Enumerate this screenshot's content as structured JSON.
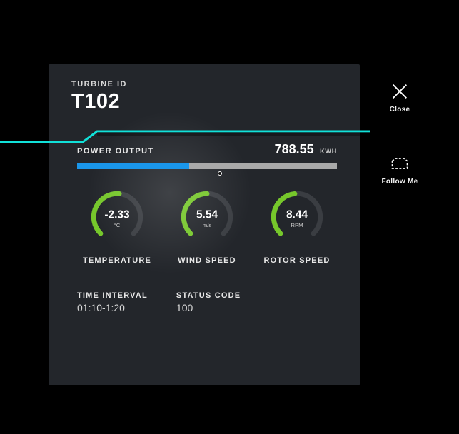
{
  "header": {
    "id_label": "TURBINE ID",
    "id_value": "T102"
  },
  "power": {
    "label": "POWER OUTPUT",
    "value": "788.55",
    "unit": "KWH",
    "fill_pct": 43,
    "handle_pct": 55
  },
  "gauges": {
    "temperature": {
      "value": "-2.33",
      "unit": "°C",
      "label": "TEMPERATURE",
      "arc_pct": 52
    },
    "wind": {
      "value": "5.54",
      "unit": "m/s",
      "label": "WIND SPEED",
      "arc_pct": 50
    },
    "rotor": {
      "value": "8.44",
      "unit": "RPM",
      "label": "ROTOR SPEED",
      "arc_pct": 48
    }
  },
  "info": {
    "interval_label": "TIME INTERVAL",
    "interval_value": "01:10-1:20",
    "status_label": "STATUS CODE",
    "status_value": "100"
  },
  "actions": {
    "close": "Close",
    "follow": "Follow Me"
  },
  "colors": {
    "accent": "#11e1d9",
    "bar_fill": "#1a96ea",
    "gauge_fill": "#76c72b"
  }
}
